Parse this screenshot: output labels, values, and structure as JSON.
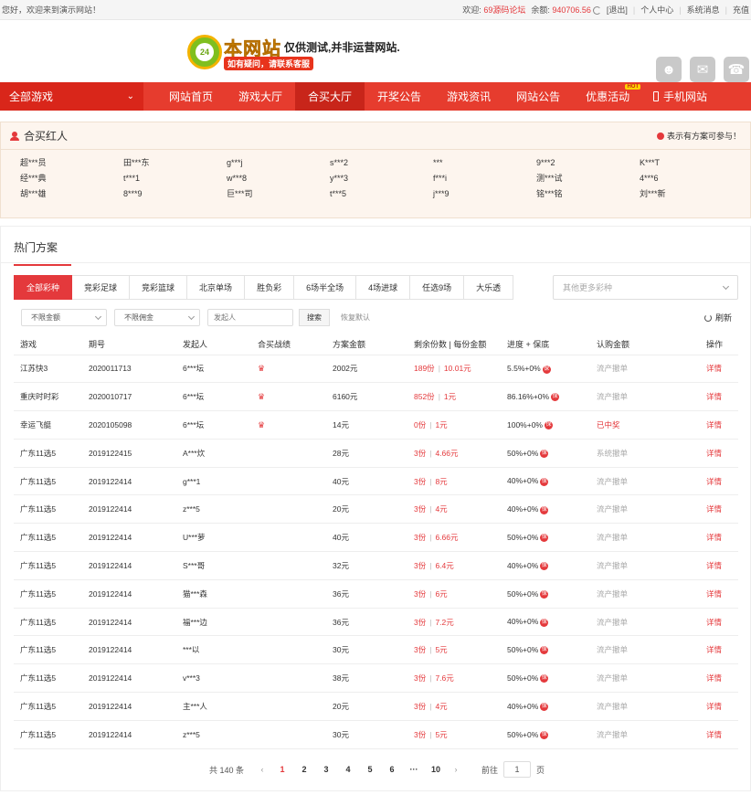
{
  "topbar": {
    "welcome": "您好，欢迎来到演示网站！",
    "welcome_label": "欢迎:",
    "username": "69源码论坛",
    "balance_label": "余额:",
    "balance": "940706.56",
    "logout": "[退出]",
    "personal": "个人中心",
    "messages": "系统消息",
    "recharge": "充值"
  },
  "logo": {
    "badge": "24",
    "big": "本网站",
    "test": "仅供测试,并非运营网站.",
    "slogan": "如有疑问，请联系客服"
  },
  "nav": {
    "all_games": "全部游戏",
    "items": [
      "网站首页",
      "游戏大厅",
      "合买大厅",
      "开奖公告",
      "游戏资讯",
      "网站公告",
      "优惠活动"
    ],
    "hot_badge": "HOT",
    "mobile": "手机网站"
  },
  "experts": {
    "title": "合买红人",
    "hint": "表示有方案可参与！",
    "names": [
      "超***员",
      "田***东",
      "g***j",
      "s***2",
      "***",
      "9***2",
      "K***T",
      "经***典",
      "t***1",
      "w***8",
      "y***3",
      "f***i",
      "测***试",
      "4***6",
      "胡***雄",
      "8***9",
      "巨***司",
      "t***5",
      "j***9",
      "铭***铭",
      "刘***新"
    ]
  },
  "hot": {
    "title": "热门方案",
    "tabs": [
      "全部彩种",
      "竞彩足球",
      "竞彩篮球",
      "北京单场",
      "胜负彩",
      "6场半全场",
      "4场进球",
      "任选9场",
      "大乐透"
    ],
    "more_placeholder": "其他更多彩种",
    "amount_select": "不限金额",
    "commission_select": "不限佣金",
    "initiator_placeholder": "发起人",
    "search": "搜索",
    "reset": "恢复默认",
    "refresh": "刷新",
    "columns": [
      "游戏",
      "期号",
      "发起人",
      "合买战绩",
      "方案金额",
      "剩余份数 | 每份金额",
      "进度 + 保底",
      "认购金额",
      "操作"
    ],
    "rows": [
      {
        "game": "江苏快3",
        "issue": "2020011713",
        "user": "6***坛",
        "trophy": true,
        "amount": "2002元",
        "left": "189份",
        "each": "10.01元",
        "progress": "5.5%+0%",
        "status": "流产撤单",
        "status_red": false,
        "action": "详情"
      },
      {
        "game": "重庆时时彩",
        "issue": "2020010717",
        "user": "6***坛",
        "trophy": true,
        "amount": "6160元",
        "left": "852份",
        "each": "1元",
        "progress": "86.16%+0%",
        "status": "流产撤单",
        "status_red": false,
        "action": "详情"
      },
      {
        "game": "幸运飞艇",
        "issue": "2020105098",
        "user": "6***坛",
        "trophy": true,
        "amount": "14元",
        "left": "0份",
        "each": "1元",
        "progress": "100%+0%",
        "status": "已中奖",
        "status_red": true,
        "action": "详情"
      },
      {
        "game": "广东11选5",
        "issue": "2019122415",
        "user": "A***炊",
        "trophy": false,
        "amount": "28元",
        "left": "3份",
        "each": "4.66元",
        "progress": "50%+0%",
        "status": "系统撤单",
        "status_red": false,
        "action": "详情"
      },
      {
        "game": "广东11选5",
        "issue": "2019122414",
        "user": "g***1",
        "trophy": false,
        "amount": "40元",
        "left": "3份",
        "each": "8元",
        "progress": "40%+0%",
        "status": "流产撤单",
        "status_red": false,
        "action": "详情"
      },
      {
        "game": "广东11选5",
        "issue": "2019122414",
        "user": "z***5",
        "trophy": false,
        "amount": "20元",
        "left": "3份",
        "each": "4元",
        "progress": "40%+0%",
        "status": "流产撤单",
        "status_red": false,
        "action": "详情"
      },
      {
        "game": "广东11选5",
        "issue": "2019122414",
        "user": "U***萝",
        "trophy": false,
        "amount": "40元",
        "left": "3份",
        "each": "6.66元",
        "progress": "50%+0%",
        "status": "流产撤单",
        "status_red": false,
        "action": "详情"
      },
      {
        "game": "广东11选5",
        "issue": "2019122414",
        "user": "S***哥",
        "trophy": false,
        "amount": "32元",
        "left": "3份",
        "each": "6.4元",
        "progress": "40%+0%",
        "status": "流产撤单",
        "status_red": false,
        "action": "详情"
      },
      {
        "game": "广东11选5",
        "issue": "2019122414",
        "user": "猫***森",
        "trophy": false,
        "amount": "36元",
        "left": "3份",
        "each": "6元",
        "progress": "50%+0%",
        "status": "流产撤单",
        "status_red": false,
        "action": "详情"
      },
      {
        "game": "广东11选5",
        "issue": "2019122414",
        "user": "福***边",
        "trophy": false,
        "amount": "36元",
        "left": "3份",
        "each": "7.2元",
        "progress": "40%+0%",
        "status": "流产撤单",
        "status_red": false,
        "action": "详情"
      },
      {
        "game": "广东11选5",
        "issue": "2019122414",
        "user": "***以",
        "trophy": false,
        "amount": "30元",
        "left": "3份",
        "each": "5元",
        "progress": "50%+0%",
        "status": "流产撤单",
        "status_red": false,
        "action": "详情"
      },
      {
        "game": "广东11选5",
        "issue": "2019122414",
        "user": "v***3",
        "trophy": false,
        "amount": "38元",
        "left": "3份",
        "each": "7.6元",
        "progress": "50%+0%",
        "status": "流产撤单",
        "status_red": false,
        "action": "详情"
      },
      {
        "game": "广东11选5",
        "issue": "2019122414",
        "user": "主***人",
        "trophy": false,
        "amount": "20元",
        "left": "3份",
        "each": "4元",
        "progress": "40%+0%",
        "status": "流产撤单",
        "status_red": false,
        "action": "详情"
      },
      {
        "game": "广东11选5",
        "issue": "2019122414",
        "user": "z***5",
        "trophy": false,
        "amount": "30元",
        "left": "3份",
        "each": "5元",
        "progress": "50%+0%",
        "status": "流产撤单",
        "status_red": false,
        "action": "详情"
      }
    ],
    "bao_label": "保"
  },
  "pager": {
    "total": "共 140 条",
    "pages": [
      "1",
      "2",
      "3",
      "4",
      "5",
      "6",
      "···",
      "10"
    ],
    "current": "1",
    "goto_label": "前往",
    "goto_value": "1",
    "page_label": "页"
  },
  "colors": {
    "accent": "#e4393c",
    "nav": "#e63c2e"
  }
}
